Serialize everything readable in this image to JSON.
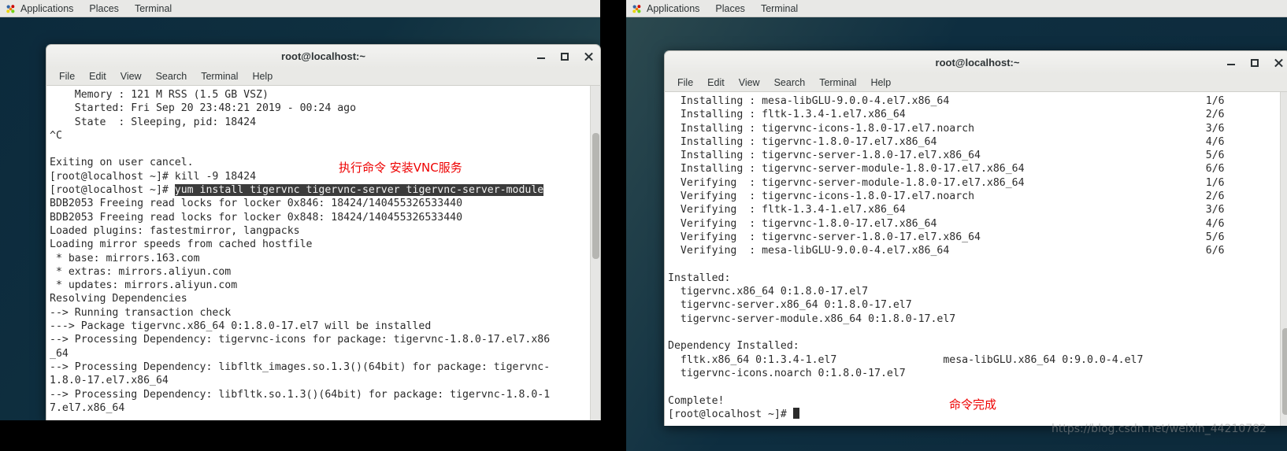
{
  "panels": {
    "left": {
      "items": [
        "Applications",
        "Places",
        "Terminal"
      ],
      "icon": "applications-icon"
    },
    "right": {
      "items": [
        "Applications",
        "Places",
        "Terminal"
      ],
      "icon": "applications-icon"
    }
  },
  "windows": {
    "left": {
      "title": "root@localhost:~",
      "menu": [
        "File",
        "Edit",
        "View",
        "Search",
        "Terminal",
        "Help"
      ],
      "buttons": {
        "minimize": "minimize-icon",
        "maximize": "maximize-icon",
        "close": "close-icon"
      },
      "prompt": "[root@localhost ~]#",
      "highlighted_command": "yum install tigervnc tigervnc-server tigervnc-server-module",
      "lines_before": [
        "    Memory : 121 M RSS (1.5 GB VSZ)",
        "    Started: Fri Sep 20 23:48:21 2019 - 00:24 ago",
        "    State  : Sleeping, pid: 18424",
        "^C",
        "",
        "Exiting on user cancel.",
        "[root@localhost ~]# kill -9 18424"
      ],
      "lines_after": [
        "BDB2053 Freeing read locks for locker 0x846: 18424/140455326533440",
        "BDB2053 Freeing read locks for locker 0x848: 18424/140455326533440",
        "Loaded plugins: fastestmirror, langpacks",
        "Loading mirror speeds from cached hostfile",
        " * base: mirrors.163.com",
        " * extras: mirrors.aliyun.com",
        " * updates: mirrors.aliyun.com",
        "Resolving Dependencies",
        "--> Running transaction check",
        "---> Package tigervnc.x86_64 0:1.8.0-17.el7 will be installed",
        "--> Processing Dependency: tigervnc-icons for package: tigervnc-1.8.0-17.el7.x86",
        "_64",
        "--> Processing Dependency: libfltk_images.so.1.3()(64bit) for package: tigervnc-",
        "1.8.0-17.el7.x86_64",
        "--> Processing Dependency: libfltk.so.1.3()(64bit) for package: tigervnc-1.8.0-1",
        "7.el7.x86_64"
      ],
      "annotation": "执行命令  安装VNC服务"
    },
    "right": {
      "title": "root@localhost:~",
      "menu": [
        "File",
        "Edit",
        "View",
        "Search",
        "Terminal",
        "Help"
      ],
      "buttons": {
        "minimize": "minimize-icon",
        "maximize": "maximize-icon",
        "close": "close-icon"
      },
      "prompt": "[root@localhost ~]#",
      "progress_rows": [
        {
          "text": "  Installing : mesa-libGLU-9.0.0-4.el7.x86_64",
          "count": "1/6"
        },
        {
          "text": "  Installing : fltk-1.3.4-1.el7.x86_64",
          "count": "2/6"
        },
        {
          "text": "  Installing : tigervnc-icons-1.8.0-17.el7.noarch",
          "count": "3/6"
        },
        {
          "text": "  Installing : tigervnc-1.8.0-17.el7.x86_64",
          "count": "4/6"
        },
        {
          "text": "  Installing : tigervnc-server-1.8.0-17.el7.x86_64",
          "count": "5/6"
        },
        {
          "text": "  Installing : tigervnc-server-module-1.8.0-17.el7.x86_64",
          "count": "6/6"
        },
        {
          "text": "  Verifying  : tigervnc-server-module-1.8.0-17.el7.x86_64",
          "count": "1/6"
        },
        {
          "text": "  Verifying  : tigervnc-icons-1.8.0-17.el7.noarch",
          "count": "2/6"
        },
        {
          "text": "  Verifying  : fltk-1.3.4-1.el7.x86_64",
          "count": "3/6"
        },
        {
          "text": "  Verifying  : tigervnc-1.8.0-17.el7.x86_64",
          "count": "4/6"
        },
        {
          "text": "  Verifying  : tigervnc-server-1.8.0-17.el7.x86_64",
          "count": "5/6"
        },
        {
          "text": "  Verifying  : mesa-libGLU-9.0.0-4.el7.x86_64",
          "count": "6/6"
        }
      ],
      "tail_lines": [
        "",
        "Installed:",
        "  tigervnc.x86_64 0:1.8.0-17.el7",
        "  tigervnc-server.x86_64 0:1.8.0-17.el7",
        "  tigervnc-server-module.x86_64 0:1.8.0-17.el7",
        "",
        "Dependency Installed:",
        "  fltk.x86_64 0:1.3.4-1.el7                 mesa-libGLU.x86_64 0:9.0.0-4.el7",
        "  tigervnc-icons.noarch 0:1.8.0-17.el7",
        "",
        "Complete!"
      ],
      "annotation": "命令完成"
    }
  },
  "watermark": "https://blog.csdn.net/weixin_44210782"
}
